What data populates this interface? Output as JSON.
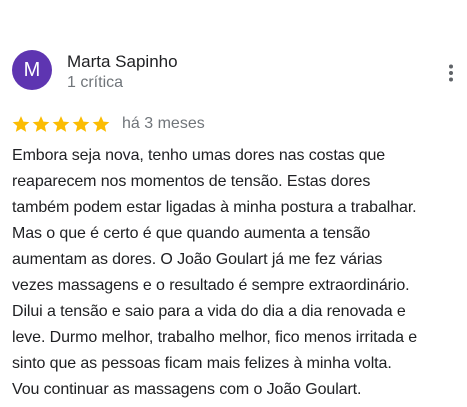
{
  "review": {
    "author": {
      "initial": "M",
      "name": "Marta Sapinho",
      "meta": "1 crítica",
      "avatar_color": "#5e35b1"
    },
    "more_icon": "more-vert-icon",
    "rating": {
      "value": 5,
      "max": 5,
      "star_color": "#fbbc04",
      "icon": "star-icon"
    },
    "age": "há 3 meses",
    "text_lines": [
      "Embora seja nova, tenho umas dores nas costas que",
      "reaparecem nos momentos de tensão. Estas dores",
      "também podem estar ligadas à minha postura a trabalhar.",
      "Mas o que é certo é que quando aumenta a tensão",
      "aumentam as dores. O João Goulart já me fez várias",
      "vezes massagens e o resultado é sempre extraordinário.",
      "Dilui a tensão e saio para a vida do dia a dia renovada e",
      "leve. Durmo melhor, trabalho melhor, fico menos irritada e",
      "sinto que as pessoas ficam mais felizes à minha volta.",
      "Vou continuar as massagens com o João Goulart."
    ]
  }
}
